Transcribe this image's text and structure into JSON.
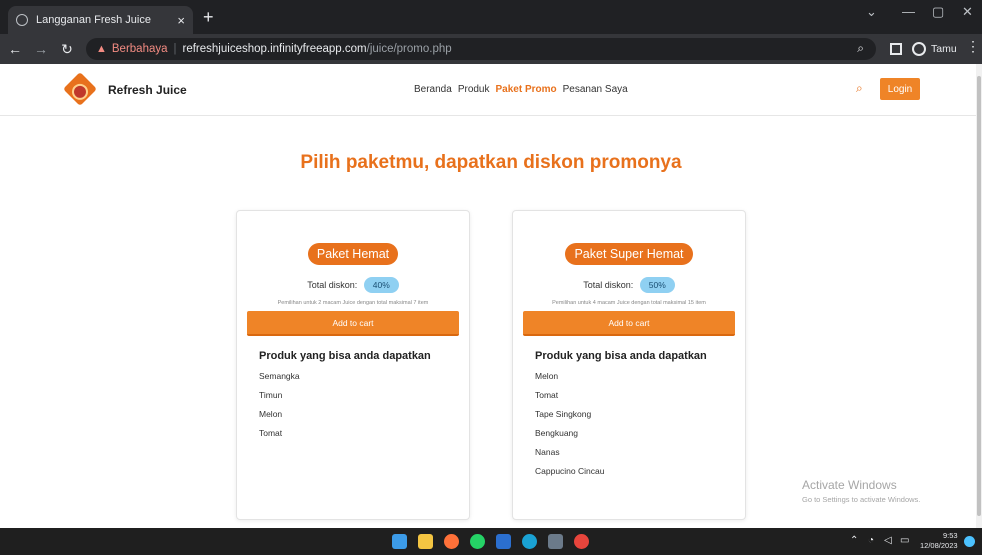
{
  "browser": {
    "tab_title": "Langganan Fresh Juice",
    "tab_close": "×",
    "new_tab": "+",
    "warning": "Berbahaya",
    "url_host": "refreshjuiceshop.infinityfreeapp.com",
    "url_path": "/juice/promo.php",
    "profile_name": "Tamu"
  },
  "site": {
    "brand": "Refresh Juice",
    "nav": [
      "Beranda",
      "Produk",
      "Paket Promo",
      "Pesanan Saya"
    ],
    "login": "Login"
  },
  "heading": "Pilih paketmu, dapatkan diskon promonya",
  "cards": [
    {
      "name": "Paket Hemat",
      "discount_label": "Total diskon:",
      "discount": "40%",
      "description": "Pemilihan untuk 2 macam Juice dengan total maksimal 7 item",
      "button": "Add to cart",
      "products_title": "Produk yang bisa anda dapatkan",
      "products": [
        "Semangka",
        "Timun",
        "Melon",
        "Tomat"
      ]
    },
    {
      "name": "Paket Super Hemat",
      "discount_label": "Total diskon:",
      "discount": "50%",
      "description": "Pemilihan untuk 4 macam Juice dengan total maksimal 15 item",
      "button": "Add to cart",
      "products_title": "Produk yang bisa anda dapatkan",
      "products": [
        "Melon",
        "Tomat",
        "Tape Singkong",
        "Bengkuang",
        "Nanas",
        "Cappucino Cincau"
      ]
    }
  ],
  "watermark": {
    "title": "Activate Windows",
    "subtitle": "Go to Settings to activate Windows."
  },
  "taskbar": {
    "time": "9:53",
    "date": "12/08/2023"
  },
  "colors": {
    "accent": "#e8711c",
    "badge": "#8fd0f2"
  }
}
